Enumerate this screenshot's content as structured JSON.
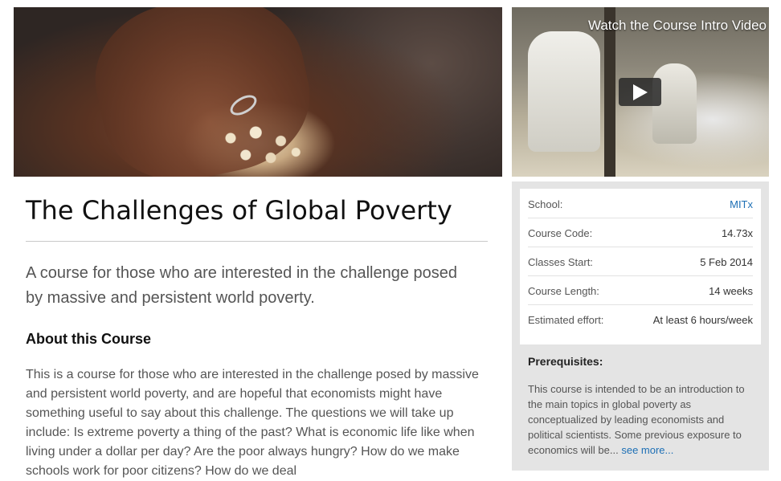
{
  "video": {
    "title": "Watch the Course Intro Video",
    "play_icon": "play-icon"
  },
  "course": {
    "title": "The Challenges of Global Poverty",
    "subtitle": "A course for those who are interested in the challenge posed by massive and persistent world poverty.",
    "about_heading": "About this Course",
    "about_body": "This is a course for those who are interested in the challenge posed by massive and persistent world poverty, and are hopeful that economists might have something useful to say about this challenge. The questions we will take up include: Is extreme poverty a thing of the past? What is economic life like when living under a dollar per day? Are the poor always hungry? How do we make schools work for poor citizens? How do we deal"
  },
  "sidebar": {
    "details": [
      {
        "label": "School:",
        "value": "MITx"
      },
      {
        "label": "Course Code:",
        "value": "14.73x"
      },
      {
        "label": "Classes Start:",
        "value": "5 Feb 2014"
      },
      {
        "label": "Course Length:",
        "value": "14 weeks"
      },
      {
        "label": "Estimated effort:",
        "value": "At least 6 hours/week"
      }
    ],
    "prereq_heading": "Prerequisites:",
    "prereq_body": "This course is intended to be an introduction to the main topics in global poverty as conceptualized by leading economists and political scientists. Some previous exposure to economics will be...",
    "see_more": "see more..."
  },
  "colors": {
    "link": "#1d6fb5",
    "sidebar_bg": "#e4e4e4"
  }
}
